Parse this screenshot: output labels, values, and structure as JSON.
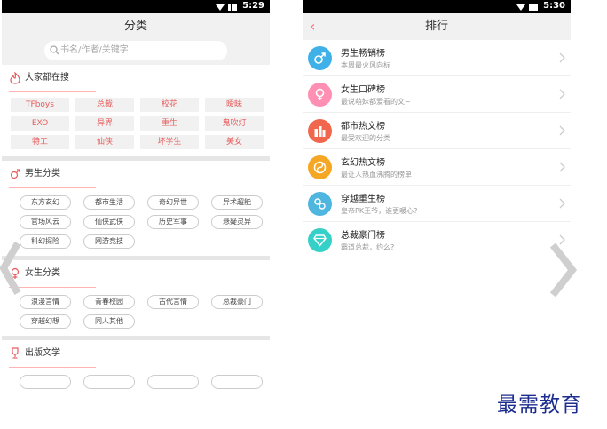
{
  "left_phone": {
    "status": {
      "time": "5:29"
    },
    "header": {
      "title": "分类"
    },
    "search": {
      "placeholder": "书名/作者/关键字"
    },
    "hot": {
      "title": "大家都在搜",
      "items": [
        "TFboys",
        "总裁",
        "校花",
        "暧昧",
        "EXO",
        "异界",
        "重生",
        "鬼吹灯",
        "特工",
        "仙侠",
        "坏学生",
        "美女"
      ]
    },
    "male": {
      "title": "男生分类",
      "items": [
        "东方玄幻",
        "都市生活",
        "奇幻异世",
        "异术超能",
        "官场风云",
        "仙侠武侠",
        "历史军事",
        "悬疑灵异",
        "科幻探险",
        "网游竞技"
      ]
    },
    "female": {
      "title": "女生分类",
      "items": [
        "浪漫言情",
        "青春校园",
        "古代言情",
        "总裁豪门",
        "穿越幻想",
        "同人其他"
      ]
    },
    "publish": {
      "title": "出版文学"
    }
  },
  "right_phone": {
    "status": {
      "time": "5:30"
    },
    "header": {
      "title": "排行"
    },
    "items": [
      {
        "title": "男生畅销榜",
        "sub": "本周最火风向标",
        "color": "#3fb1e8",
        "icon": "male-icon"
      },
      {
        "title": "女生口碑榜",
        "sub": "最说萌妹都爱看的文~",
        "color": "#ff8fb3",
        "icon": "female-icon"
      },
      {
        "title": "都市热文榜",
        "sub": "最受欢迎的分类",
        "color": "#f0674e",
        "icon": "city-icon"
      },
      {
        "title": "玄幻热文榜",
        "sub": "最让人热血沸腾的榜单",
        "color": "#f5a623",
        "icon": "fantasy-icon"
      },
      {
        "title": "穿越重生榜",
        "sub": "皇帝PK王爷，谁更暖心?",
        "color": "#4fb6e0",
        "icon": "timetravel-icon"
      },
      {
        "title": "总裁豪门榜",
        "sub": "霸道总裁，约么?",
        "color": "#35d0c8",
        "icon": "diamond-icon"
      }
    ]
  },
  "watermark": "最需教育"
}
